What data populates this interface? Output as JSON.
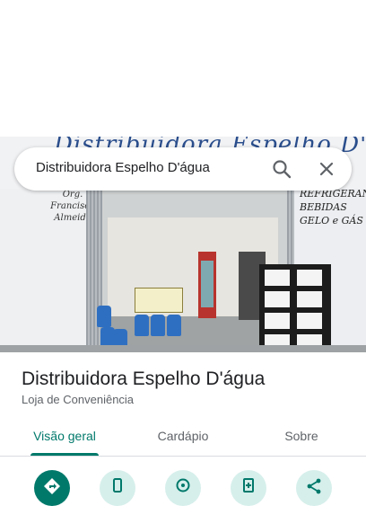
{
  "search": {
    "query": "Distribuidora Espelho D'água"
  },
  "place": {
    "title": "Distribuidora Espelho D'água",
    "category": "Loja de Conveniência"
  },
  "tabs": [
    {
      "label": "Visão geral",
      "active": true
    },
    {
      "label": "Cardápio",
      "active": false
    },
    {
      "label": "Sobre",
      "active": false
    }
  ],
  "photo": {
    "fascia_text": "Distribuidora Espelho D'água",
    "left_sign": [
      "Org.",
      "Francisco",
      "Almeida"
    ],
    "right_sign": [
      "REFRIGERANTES",
      "BEBIDAS",
      "GELO e GÁS"
    ]
  },
  "actions": [
    {
      "icon": "directions-icon",
      "primary": true
    },
    {
      "icon": "phone-icon",
      "primary": false
    },
    {
      "icon": "location-pin-icon",
      "primary": false
    },
    {
      "icon": "save-icon",
      "primary": false
    },
    {
      "icon": "share-icon",
      "primary": false
    }
  ],
  "colors": {
    "accent": "#00796b",
    "accent_light": "#d6efeb",
    "text_primary": "#202124",
    "text_secondary": "#5f6368"
  }
}
